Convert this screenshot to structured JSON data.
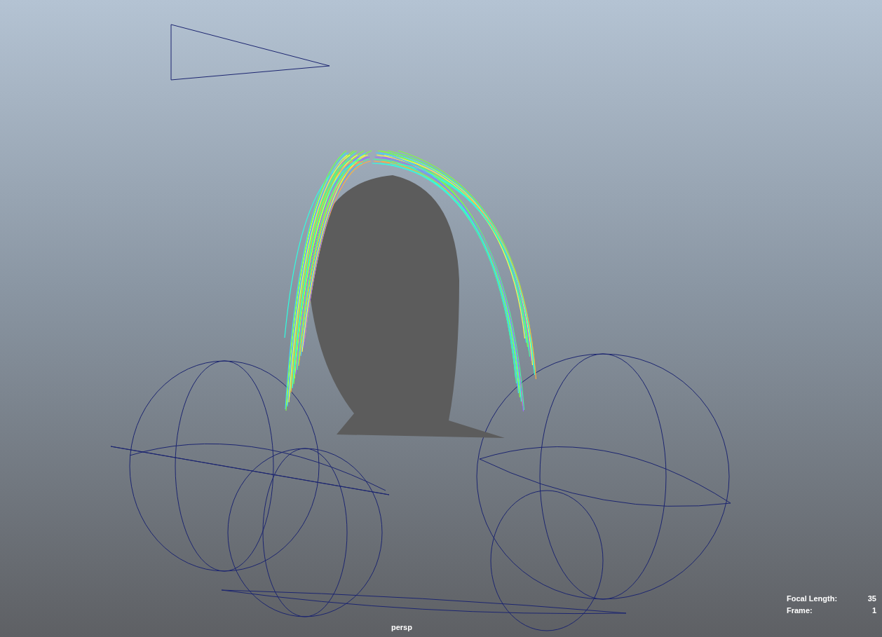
{
  "viewport": {
    "camera_name": "persp",
    "hud": [
      {
        "label": "Focal Length:",
        "value": "35"
      },
      {
        "label": "Frame:",
        "value": "1"
      }
    ]
  }
}
